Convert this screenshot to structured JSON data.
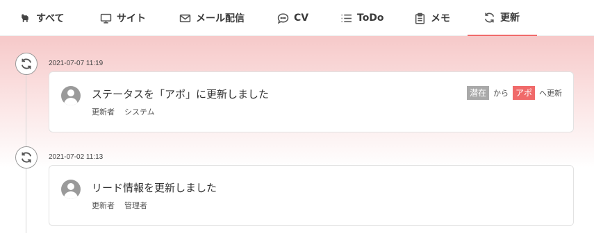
{
  "tabs": [
    {
      "label": "すべて",
      "icon": "dog-icon"
    },
    {
      "label": "サイト",
      "icon": "monitor-icon"
    },
    {
      "label": "メール配信",
      "icon": "mail-icon"
    },
    {
      "label": "CV",
      "icon": "chat-bubble-icon"
    },
    {
      "label": "ToDo",
      "icon": "list-icon"
    },
    {
      "label": "メモ",
      "icon": "clipboard-icon"
    },
    {
      "label": "更新",
      "icon": "refresh-icon",
      "active": true
    }
  ],
  "timeline": [
    {
      "datetime": "2021-07-07 11:19",
      "message": "ステータスを「アポ」に更新しました",
      "updater_label": "更新者",
      "updater": "システム",
      "status_from": "潜在",
      "from_text": "から",
      "status_to": "アポ",
      "to_text": "へ更新"
    },
    {
      "datetime": "2021-07-02 11:13",
      "message": "リード情報を更新しました",
      "updater_label": "更新者",
      "updater": "管理者"
    }
  ],
  "colors": {
    "accent": "#f06a6a",
    "badge_from": "#a9a9a9",
    "header_gradient_top": "#f6c9c9"
  }
}
